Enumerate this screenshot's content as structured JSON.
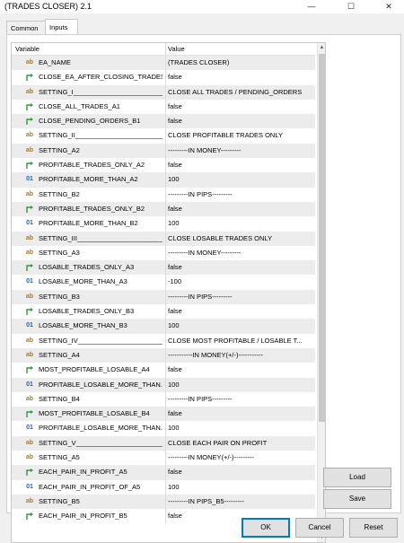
{
  "window": {
    "title": "(TRADES CLOSER) 2.1",
    "controls": [
      "—",
      "☐",
      "✕"
    ]
  },
  "tabs": [
    {
      "label": "Common",
      "active": false
    },
    {
      "label": "Inputs",
      "active": true
    }
  ],
  "table": {
    "columns": [
      "Variable",
      "Value"
    ],
    "rows": [
      {
        "type": "ab",
        "name": "EA_NAME",
        "value": "(TRADES CLOSER)"
      },
      {
        "type": "bool",
        "name": "CLOSE_EA_AFTER_CLOSING_TRADES",
        "value": "false"
      },
      {
        "type": "ab",
        "name": "SETTING_I_________________________",
        "value": "CLOSE ALL TRADES / PENDING_ORDERS"
      },
      {
        "type": "bool",
        "name": "CLOSE_ALL_TRADES_A1",
        "value": "false"
      },
      {
        "type": "bool",
        "name": "CLOSE_PENDING_ORDERS_B1",
        "value": "false"
      },
      {
        "type": "ab",
        "name": "SETTING_II_________________________",
        "value": "CLOSE PROFITABLE TRADES ONLY"
      },
      {
        "type": "ab",
        "name": "SETTING_A2",
        "value": "---------IN MONEY---------"
      },
      {
        "type": "bool",
        "name": "PROFITABLE_TRADES_ONLY_A2",
        "value": "false"
      },
      {
        "type": "num",
        "name": "PROFITABLE_MORE_THAN_A2",
        "value": "100"
      },
      {
        "type": "ab",
        "name": "SETTING_B2",
        "value": "---------IN PIPS---------"
      },
      {
        "type": "bool",
        "name": "PROFITABLE_TRADES_ONLY_B2",
        "value": "false"
      },
      {
        "type": "num",
        "name": "PROFITABLE_MORE_THAN_B2",
        "value": "100"
      },
      {
        "type": "ab",
        "name": "SETTING_III_________________________",
        "value": "CLOSE LOSABLE TRADES ONLY"
      },
      {
        "type": "ab",
        "name": "SETTING_A3",
        "value": "---------IN MONEY---------"
      },
      {
        "type": "bool",
        "name": "LOSABLE_TRADES_ONLY_A3",
        "value": "false"
      },
      {
        "type": "num",
        "name": "LOSABLE_MORE_THAN_A3",
        "value": "-100"
      },
      {
        "type": "ab",
        "name": "SETTING_B3",
        "value": "---------IN PIPS---------"
      },
      {
        "type": "bool",
        "name": "LOSABLE_TRADES_ONLY_B3",
        "value": "false"
      },
      {
        "type": "num",
        "name": "LOSABLE_MORE_THAN_B3",
        "value": "100"
      },
      {
        "type": "ab",
        "name": "SETTING_IV_________________________",
        "value": "CLOSE MOST PROFITABLE  / LOSABLE T..."
      },
      {
        "type": "ab",
        "name": "SETTING_A4",
        "value": "-----------IN MONEY(+/-)-----------"
      },
      {
        "type": "bool",
        "name": "MOST_PROFITABLE_LOSABLE_A4",
        "value": "false"
      },
      {
        "type": "num",
        "name": "PROFITABLE_LOSABLE_MORE_THAN...",
        "value": "100"
      },
      {
        "type": "ab",
        "name": "SETTING_B4",
        "value": "---------IN PIPS---------"
      },
      {
        "type": "bool",
        "name": "MOST_PROFITABLE_LOSABLE_B4",
        "value": "false"
      },
      {
        "type": "num",
        "name": "PROFITABLE_LOSABLE_MORE_THAN...",
        "value": "100"
      },
      {
        "type": "ab",
        "name": "SETTING_V_________________________",
        "value": "CLOSE EACH PAIR ON PROFIT"
      },
      {
        "type": "ab",
        "name": "SETTING_A5",
        "value": "---------IN MONEY(+/-)---------"
      },
      {
        "type": "bool",
        "name": "EACH_PAIR_IN_PROFIT_A5",
        "value": "false"
      },
      {
        "type": "num",
        "name": "EACH_PAIR_IN_PROFIT_OF_A5",
        "value": "100"
      },
      {
        "type": "ab",
        "name": "SETTING_B5",
        "value": "---------IN PIPS_B5---------"
      },
      {
        "type": "bool",
        "name": "EACH_PAIR_IN_PROFIT_B5",
        "value": "false"
      }
    ]
  },
  "icons": {
    "ab": "ab",
    "num": "01",
    "bool": "arrow-icon"
  },
  "side_buttons": {
    "load": "Load",
    "save": "Save"
  },
  "footer_buttons": {
    "ok": "OK",
    "cancel": "Cancel",
    "reset": "Reset"
  },
  "colors": {
    "bool_icon": "#2e9b3a",
    "num_icon": "#1e5fc7",
    "ab_icon": "#b07a10",
    "default_button_border": "#0078d7"
  }
}
